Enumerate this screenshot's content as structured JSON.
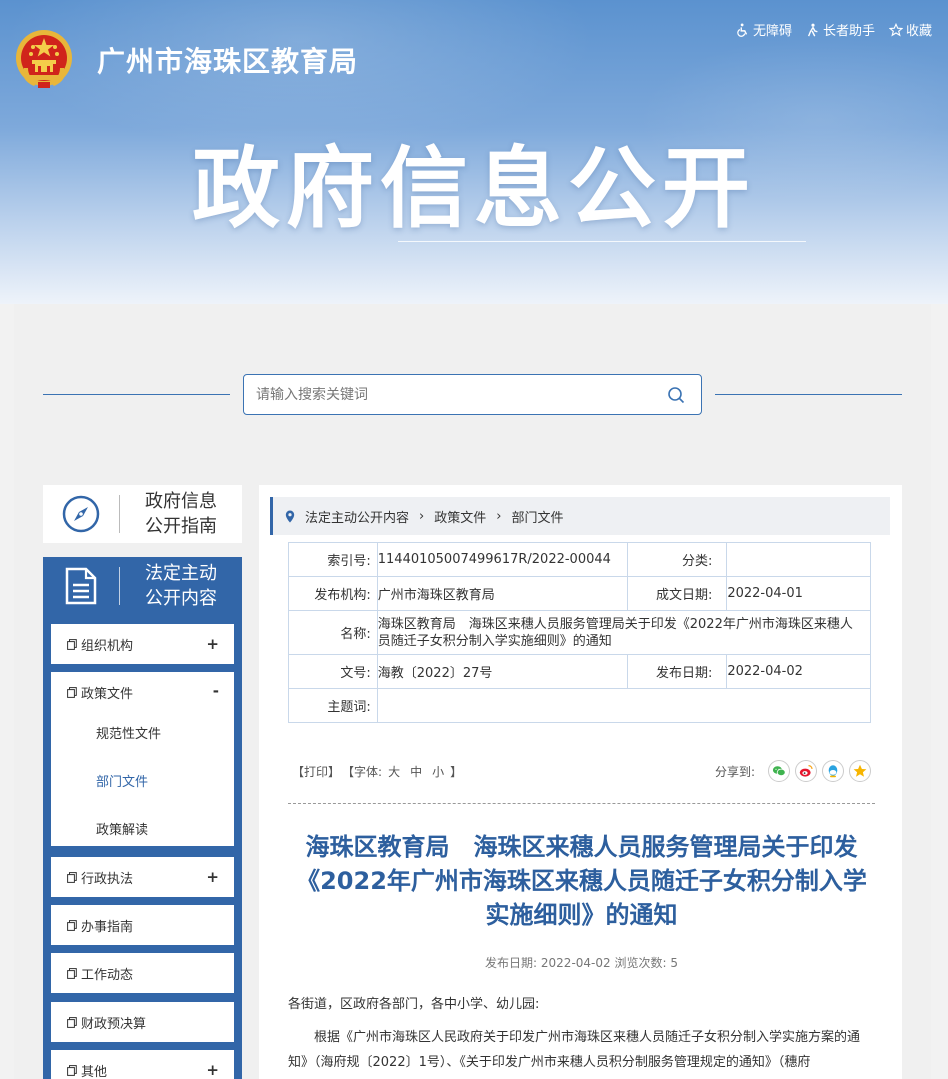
{
  "header": {
    "site_title": "广州市海珠区教育局",
    "hero_title": "政府信息公开",
    "top_links": [
      {
        "icon": "wheelchair-icon",
        "label": "无障碍"
      },
      {
        "icon": "elder-assist-icon",
        "label": "长者助手"
      },
      {
        "icon": "star-icon",
        "label": "收藏"
      }
    ]
  },
  "search": {
    "placeholder": "请输入搜索关键词",
    "icon": "search-icon"
  },
  "sidebar": {
    "guide": {
      "line1": "政府信息",
      "line2": "公开指南",
      "icon": "compass-icon"
    },
    "active": {
      "line1": "法定主动",
      "line2": "公开内容",
      "icon": "document-icon"
    },
    "menu": [
      {
        "label": "组织机构",
        "sign": "+"
      },
      {
        "label": "政策文件",
        "sign": "-",
        "children": [
          "规范性文件",
          "部门文件",
          "政策解读"
        ]
      },
      {
        "label": "行政执法",
        "sign": "+"
      },
      {
        "label": "办事指南",
        "sign": ""
      },
      {
        "label": "工作动态",
        "sign": ""
      },
      {
        "label": "财政预决算",
        "sign": ""
      },
      {
        "label": "其他",
        "sign": "+"
      }
    ]
  },
  "breadcrumb": [
    "法定主动公开内容",
    "政策文件",
    "部门文件"
  ],
  "meta": {
    "index_label": "索引号:",
    "index_value": "11440105007499617R/2022-00044",
    "category_label": "分类:",
    "category_value": "",
    "issuer_label": "发布机构:",
    "issuer_value": "广州市海珠区教育局",
    "written_label": "成文日期:",
    "written_value": "2022-04-01",
    "name_label": "名称:",
    "name_value": "海珠区教育局　海珠区来穗人员服务管理局关于印发《2022年广州市海珠区来穗人员随迁子女积分制入学实施细则》的通知",
    "docno_label": "文号:",
    "docno_value": "海教〔2022〕27号",
    "published_label": "发布日期:",
    "published_value": "2022-04-02",
    "keywords_label": "主题词:",
    "keywords_value": ""
  },
  "tools": {
    "print": "【打印】",
    "font_prefix": "【字体:",
    "font_large": "大",
    "font_medium": "中",
    "font_small": "小",
    "font_suffix": "】",
    "share_label": "分享到:",
    "share_icons": [
      "wechat-icon",
      "weibo-icon",
      "qq-icon",
      "qzone-icon"
    ]
  },
  "article": {
    "title": "海珠区教育局　海珠区来穗人员服务管理局关于印发《2022年广州市海珠区来穗人员随迁子女积分制入学实施细则》的通知",
    "meta_line": "发布日期: 2022-04-02  浏览次数: 5",
    "salutation": "各街道，区政府各部门，各中小学、幼儿园:",
    "para1": "根据《广州市海珠区人民政府关于印发广州市海珠区来穗人员随迁子女积分制入学实施方案的通知》（海府规〔2022〕1号）、《关于印发广州市来穗人员积分制服务管理规定的通知》（穗府"
  },
  "colors": {
    "brand_blue": "#3266a8",
    "title_blue": "#2d5f9e"
  }
}
